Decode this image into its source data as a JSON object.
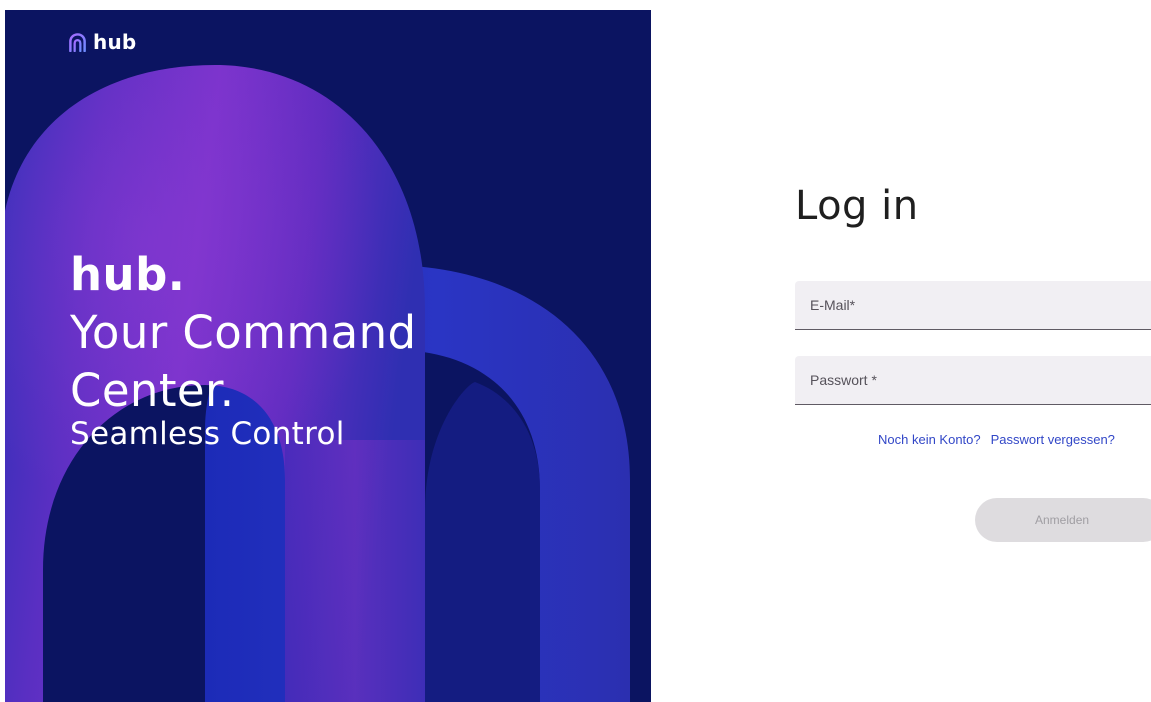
{
  "brand": {
    "logo_icon": "arch-logo-icon",
    "name": "hub"
  },
  "hero": {
    "brand_word": "hub.",
    "line1": "Your Command",
    "line2": "Center.",
    "subline": "Seamless Control",
    "colors": {
      "background": "#0b1461",
      "accent_purple": "#7a30c8",
      "accent_blue": "#2431b8"
    }
  },
  "login": {
    "title": "Log in",
    "email_placeholder": "E-Mail*",
    "password_placeholder": "Passwort *",
    "register_link": "Noch kein Konto?",
    "forgot_link": "Passwort vergessen?",
    "submit_label": "Anmelden",
    "colors": {
      "link": "#3247c7",
      "field_bg": "#f1eff3",
      "button_disabled_bg": "#dedcdf"
    }
  }
}
